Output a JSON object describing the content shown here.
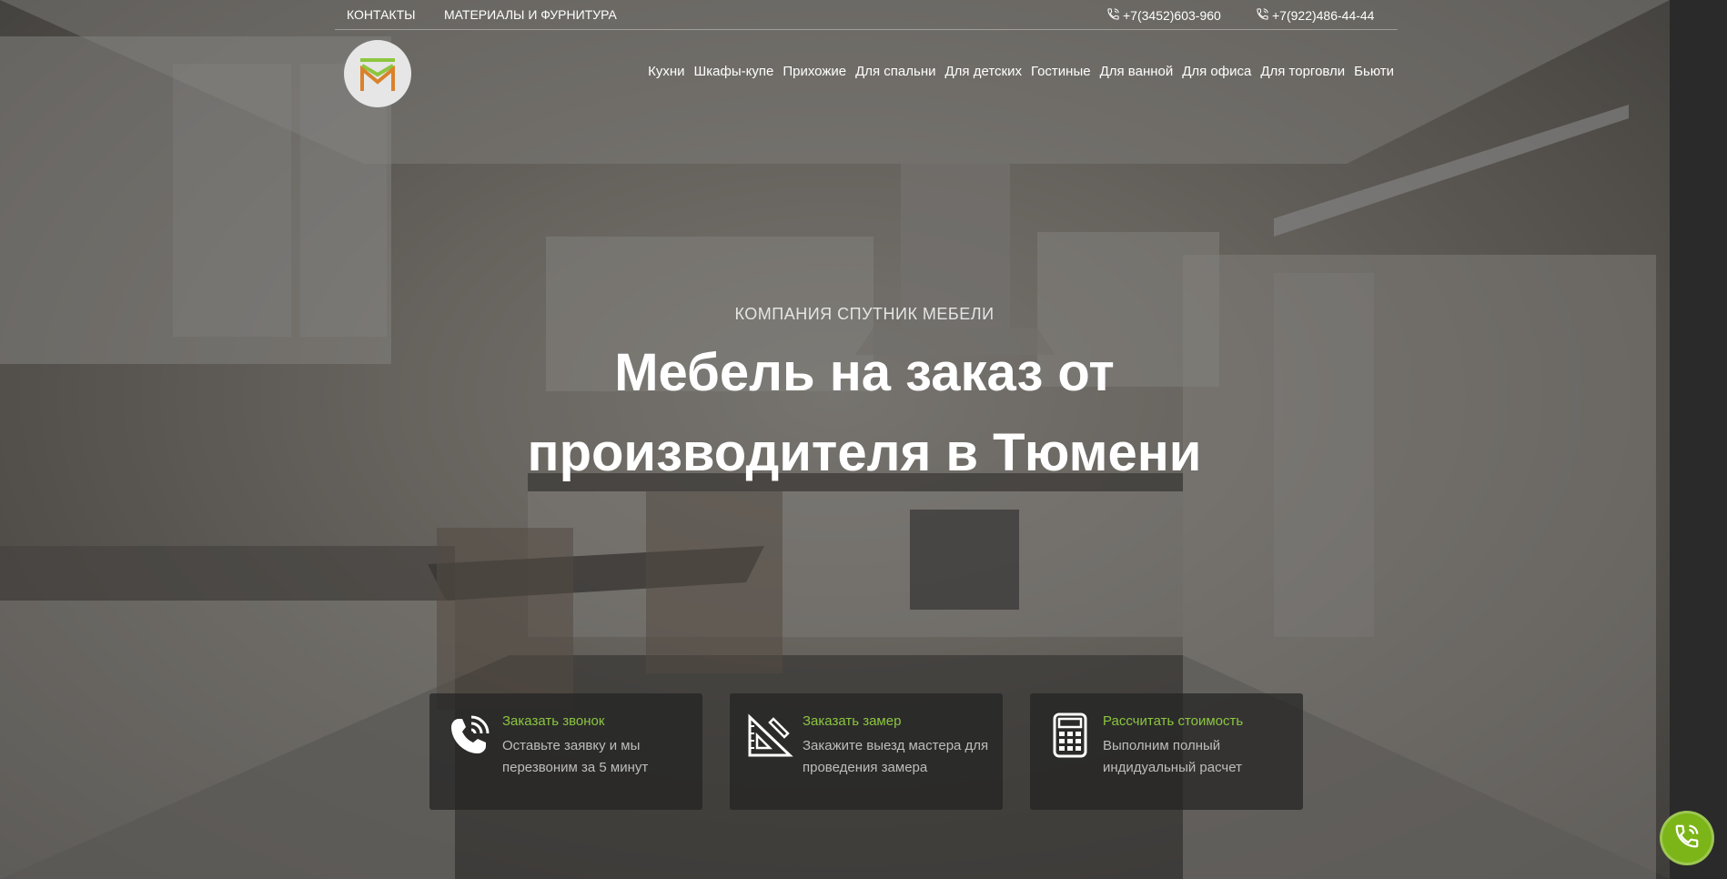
{
  "topbar": {
    "links": [
      {
        "label": "КОНТАКТЫ"
      },
      {
        "label": "МАТЕРИАЛЫ И ФУРНИТУРА"
      }
    ],
    "phones": [
      {
        "number": "+7(3452)603-960",
        "icon": "phone-icon"
      },
      {
        "number": "+7(922)486-44-44",
        "icon": "phone-icon"
      }
    ]
  },
  "logo": {
    "icon": "company-logo"
  },
  "nav": {
    "items": [
      {
        "label": "Кухни"
      },
      {
        "label": "Шкафы-купе"
      },
      {
        "label": "Прихожие"
      },
      {
        "label": "Для спальни"
      },
      {
        "label": "Для детских"
      },
      {
        "label": "Гостиные"
      },
      {
        "label": "Для ванной"
      },
      {
        "label": "Для офиса"
      },
      {
        "label": "Для торговли"
      },
      {
        "label": "Бьюти"
      }
    ]
  },
  "hero": {
    "eyebrow": "КОМПАНИЯ СПУТНИК МЕБЕЛИ",
    "title": "Мебель на заказ от производителя в Тюмени"
  },
  "cards": [
    {
      "icon": "phone-call-icon",
      "title": "Заказать звонок",
      "text": "Оставьте заявку и мы перезвоним за 5 минут"
    },
    {
      "icon": "ruler-triangle-icon",
      "title": "Заказать замер",
      "text": "Закажите выезд мастера для проведения замера"
    },
    {
      "icon": "calculator-icon",
      "title": "Рассчитать стоимость",
      "text": "Выполним полный индидуальный расчет"
    }
  ],
  "fab": {
    "icon": "phone-icon"
  },
  "colors": {
    "accent": "#8cc63f",
    "fab": "#7cb518",
    "overlay": "#262626"
  }
}
